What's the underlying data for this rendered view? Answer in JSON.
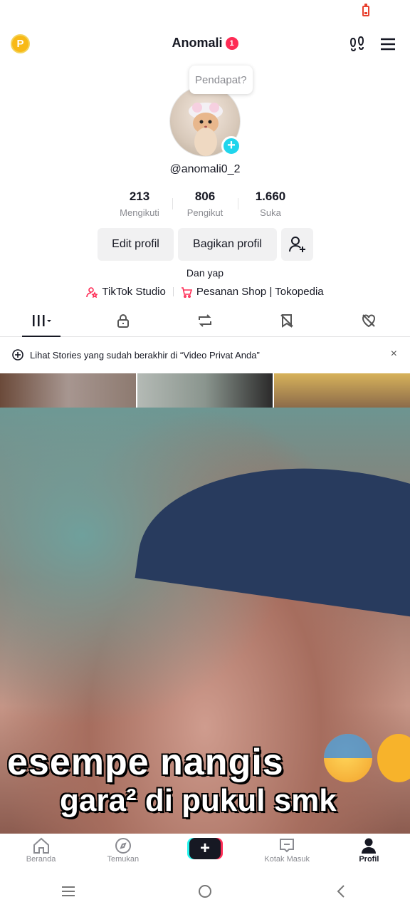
{
  "header": {
    "title": "Anomali",
    "notification_count": "1",
    "coin_label": "P"
  },
  "profile": {
    "bubble": "Pendapat?",
    "username": "@anomali0_2",
    "stats": [
      {
        "value": "213",
        "label": "Mengikuti"
      },
      {
        "value": "806",
        "label": "Pengikut"
      },
      {
        "value": "1.660",
        "label": "Suka"
      }
    ],
    "buttons": {
      "edit": "Edit profil",
      "share": "Bagikan profil"
    },
    "bio": "Dan yap",
    "links": {
      "studio": "TikTok Studio",
      "shop": "Pesanan Shop | Tokopedia"
    }
  },
  "notice": {
    "text": "Lihat Stories yang sudah berakhir di “Video Privat Anda”",
    "close": "×"
  },
  "video": {
    "caption_line1": "esempe nangis",
    "caption_line2": "gara² di pukul smk"
  },
  "bottom_nav": [
    {
      "label": "Beranda"
    },
    {
      "label": "Temukan"
    },
    {
      "label": "+"
    },
    {
      "label": "Kotak Masuk"
    },
    {
      "label": "Profil"
    }
  ],
  "colors": {
    "accent": "#fe2c55",
    "cyan": "#20d5ec",
    "coin": "#f8b916"
  }
}
